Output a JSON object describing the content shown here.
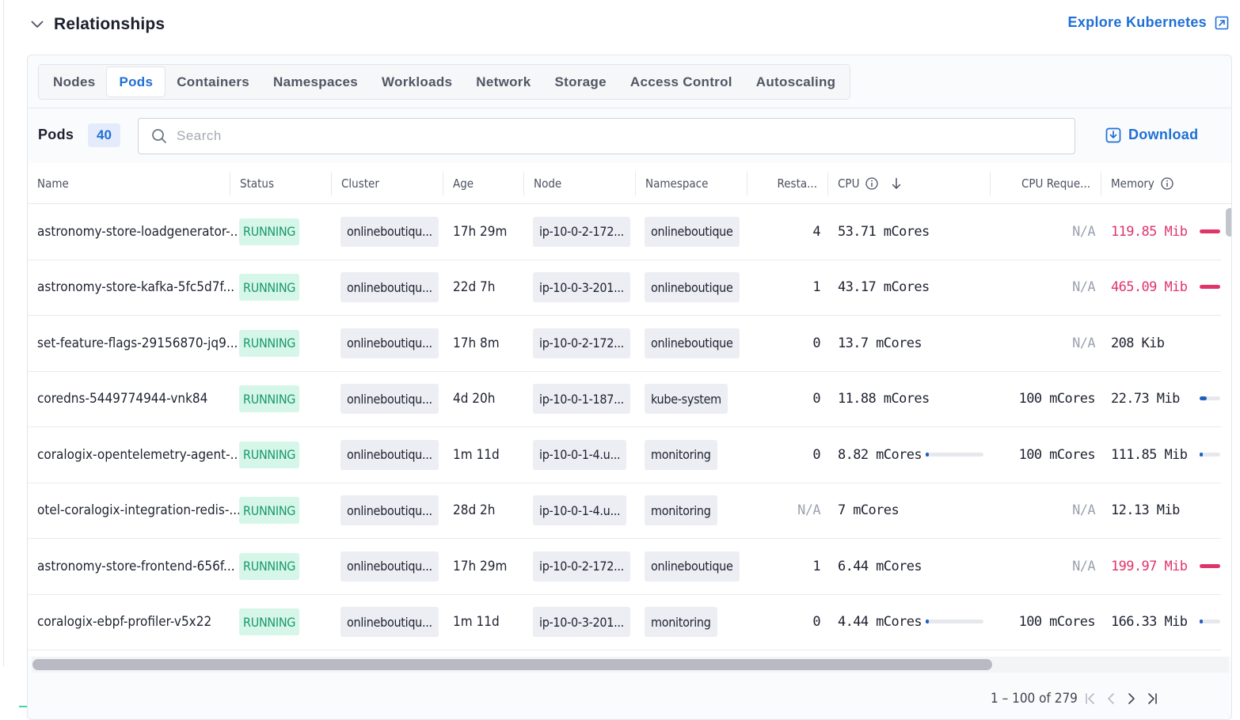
{
  "section": {
    "title": "Relationships",
    "explore_link": "Explore Kubernetes"
  },
  "tabs": [
    {
      "label": "Nodes",
      "active": false
    },
    {
      "label": "Pods",
      "active": true
    },
    {
      "label": "Containers",
      "active": false
    },
    {
      "label": "Namespaces",
      "active": false
    },
    {
      "label": "Workloads",
      "active": false
    },
    {
      "label": "Network",
      "active": false
    },
    {
      "label": "Storage",
      "active": false
    },
    {
      "label": "Access Control",
      "active": false
    },
    {
      "label": "Autoscaling",
      "active": false
    }
  ],
  "toolbar": {
    "pods_label": "Pods",
    "pods_count": "40",
    "search_placeholder": "Search",
    "search_value": "",
    "download_label": "Download"
  },
  "columns": {
    "name": "Name",
    "status": "Status",
    "cluster": "Cluster",
    "age": "Age",
    "node": "Node",
    "namespace": "Namespace",
    "restarts": "Resta...",
    "cpu": "CPU",
    "cpu_request": "CPU Reque...",
    "memory": "Memory"
  },
  "colors": {
    "accent": "#1f6fd6",
    "running_bg": "#d6f6ea",
    "running_text": "#18996c",
    "memory_high": "#e0356b",
    "usage_blue": "#1e5fbf"
  },
  "rows": [
    {
      "name": "astronomy-store-loadgenerator-...",
      "status": "RUNNING",
      "cluster": "onlineboutiqu...",
      "age": "17h 29m",
      "node": "ip-10-0-2-172...",
      "namespace": "onlineboutique",
      "restarts": "4",
      "cpu": "53.71 mCores",
      "cpu_request": "N/A",
      "memory": "119.85 Mib",
      "memory_high": true,
      "cpu_usage": null,
      "memory_usage": 1.0,
      "memory_bar": "red"
    },
    {
      "name": "astronomy-store-kafka-5fc5d7f...",
      "status": "RUNNING",
      "cluster": "onlineboutiqu...",
      "age": "22d 7h",
      "node": "ip-10-0-3-201...",
      "namespace": "onlineboutique",
      "restarts": "1",
      "cpu": "43.17 mCores",
      "cpu_request": "N/A",
      "memory": "465.09 Mib",
      "memory_high": true,
      "cpu_usage": null,
      "memory_usage": 1.0,
      "memory_bar": "red"
    },
    {
      "name": "set-feature-flags-29156870-jq9...",
      "status": "RUNNING",
      "cluster": "onlineboutiqu...",
      "age": "17h 8m",
      "node": "ip-10-0-2-172...",
      "namespace": "onlineboutique",
      "restarts": "0",
      "cpu": "13.7 mCores",
      "cpu_request": "N/A",
      "memory": "208 Kib",
      "memory_high": false,
      "cpu_usage": null,
      "memory_usage": null,
      "memory_bar": null
    },
    {
      "name": "coredns-5449774944-vnk84",
      "status": "RUNNING",
      "cluster": "onlineboutiqu...",
      "age": "4d 20h",
      "node": "ip-10-0-1-187...",
      "namespace": "kube-system",
      "restarts": "0",
      "cpu": "11.88 mCores",
      "cpu_request": "100 mCores",
      "memory": "22.73 Mib",
      "memory_high": false,
      "cpu_usage": null,
      "memory_usage": 0.35,
      "memory_bar": "blue"
    },
    {
      "name": "coralogix-opentelemetry-agent-...",
      "status": "RUNNING",
      "cluster": "onlineboutiqu...",
      "age": "1m 11d",
      "node": "ip-10-0-1-4.u...",
      "namespace": "monitoring",
      "restarts": "0",
      "cpu": "8.82 mCores",
      "cpu_request": "100 mCores",
      "memory": "111.85 Mib",
      "memory_high": false,
      "cpu_usage": 0.04,
      "memory_usage": 0.12,
      "memory_bar": "blue"
    },
    {
      "name": "otel-coralogix-integration-redis-...",
      "status": "RUNNING",
      "cluster": "onlineboutiqu...",
      "age": "28d 2h",
      "node": "ip-10-0-1-4.u...",
      "namespace": "monitoring",
      "restarts": "N/A",
      "cpu": "7 mCores",
      "cpu_request": "N/A",
      "memory": "12.13 Mib",
      "memory_high": false,
      "cpu_usage": null,
      "memory_usage": null,
      "memory_bar": null
    },
    {
      "name": "astronomy-store-frontend-656f...",
      "status": "RUNNING",
      "cluster": "onlineboutiqu...",
      "age": "17h 29m",
      "node": "ip-10-0-2-172...",
      "namespace": "onlineboutique",
      "restarts": "1",
      "cpu": "6.44 mCores",
      "cpu_request": "N/A",
      "memory": "199.97 Mib",
      "memory_high": true,
      "cpu_usage": null,
      "memory_usage": 1.0,
      "memory_bar": "red"
    },
    {
      "name": "coralogix-ebpf-profiler-v5x22",
      "status": "RUNNING",
      "cluster": "onlineboutiqu...",
      "age": "1m 11d",
      "node": "ip-10-0-3-201...",
      "namespace": "monitoring",
      "restarts": "0",
      "cpu": "4.44 mCores",
      "cpu_request": "100 mCores",
      "memory": "166.33 Mib",
      "memory_high": false,
      "cpu_usage": 0.02,
      "memory_usage": 0.12,
      "memory_bar": "blue"
    }
  ],
  "pagination": {
    "range_label": "1 – 100 of 279"
  }
}
